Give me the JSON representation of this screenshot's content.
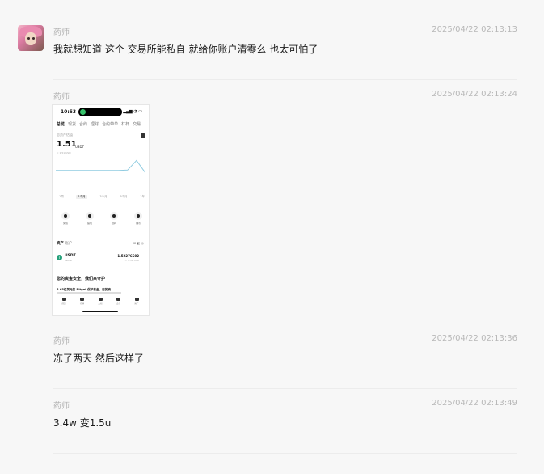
{
  "messages": [
    {
      "sender": "药师",
      "time": "2025/04/22 02:13:13",
      "text": "我就想知道 这个 交易所能私自 就给你账户清零么 也太可怕了"
    },
    {
      "sender": "药师",
      "time": "2025/04/22 02:13:24"
    },
    {
      "sender": "药师",
      "time": "2025/04/22 02:13:36",
      "text": "冻了两天 然后这样了"
    },
    {
      "sender": "药师",
      "time": "2025/04/22 02:13:49",
      "text": "3.4w 变1.5u"
    }
  ],
  "phone": {
    "time": "10:53",
    "tabs": [
      "总览",
      "现货",
      "合约",
      "理财",
      "合约带单",
      "杠杆",
      "交易"
    ],
    "label": "总资产估值",
    "balance": "1.51",
    "unit": "USDT",
    "sub": "≈ 1.51 USD",
    "ranges": [
      "1周",
      "1个月",
      "3个月",
      "6个月",
      "1年"
    ],
    "range_active": 1,
    "actions": [
      "充值",
      "提现",
      "划转",
      "赚币"
    ],
    "asset_tabs": [
      "资产",
      "账户"
    ],
    "coin": "USDT",
    "coin_sub": "Tether",
    "coin_amount": "1.52276602",
    "coin_usd": "≈ 1.51 USD",
    "banner_title": "您的资金安全，我们来守护",
    "banner_sub": "5.65亿美元的 Bitget 保护基金，您的资",
    "nav": [
      "首页",
      "行情",
      "交易",
      "合约",
      "资产"
    ],
    "chart": {
      "values": [
        0.62,
        0.62,
        0.62,
        0.62,
        0.62,
        0.62,
        0.62,
        0.62,
        0.63,
        0.9,
        0.55
      ],
      "line_color": "#8fcbe0"
    }
  }
}
